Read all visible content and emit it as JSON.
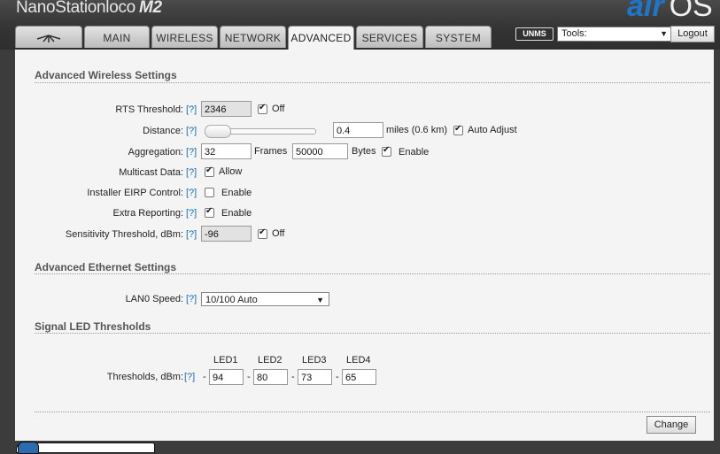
{
  "header": {
    "product": "NanoStation",
    "product_suffix": "loco",
    "model": "M2",
    "logo_air": "air",
    "logo_os": "OS"
  },
  "tabs": [
    {
      "label": "",
      "icon": "ubiquiti-logo-icon"
    },
    {
      "label": "MAIN"
    },
    {
      "label": "WIRELESS"
    },
    {
      "label": "NETWORK"
    },
    {
      "label": "ADVANCED",
      "active": true
    },
    {
      "label": "SERVICES"
    },
    {
      "label": "SYSTEM"
    }
  ],
  "toolbar": {
    "unms_label": "UNMS",
    "tools_value": "Tools:",
    "logout_label": "Logout"
  },
  "help_label": "[?]",
  "wireless": {
    "title": "Advanced Wireless Settings",
    "rts_label": "RTS Threshold:",
    "rts_value": "2346",
    "rts_off_label": "Off",
    "distance_label": "Distance:",
    "distance_value": "0.4",
    "distance_unit": "miles (0.6 km)",
    "auto_adjust_label": "Auto Adjust",
    "aggregation_label": "Aggregation:",
    "aggregation_frames": "32",
    "frames_label": "Frames",
    "aggregation_bytes": "50000",
    "bytes_label": "Bytes",
    "aggregation_enable_label": "Enable",
    "multicast_label": "Multicast Data:",
    "multicast_allow_label": "Allow",
    "eirp_label": "Installer EIRP Control:",
    "eirp_enable_label": "Enable",
    "extra_label": "Extra Reporting:",
    "extra_enable_label": "Enable",
    "sensitivity_label": "Sensitivity Threshold, dBm:",
    "sensitivity_value": "-96",
    "sensitivity_off_label": "Off"
  },
  "ethernet": {
    "title": "Advanced Ethernet Settings",
    "lan0_label": "LAN0 Speed:",
    "lan0_value": "10/100 Auto"
  },
  "led": {
    "title": "Signal LED Thresholds",
    "thresholds_label": "Thresholds, dBm:",
    "dash": "-",
    "headers": [
      "LED1",
      "LED2",
      "LED3",
      "LED4"
    ],
    "values": [
      "94",
      "80",
      "73",
      "65"
    ]
  },
  "change_label": "Change"
}
